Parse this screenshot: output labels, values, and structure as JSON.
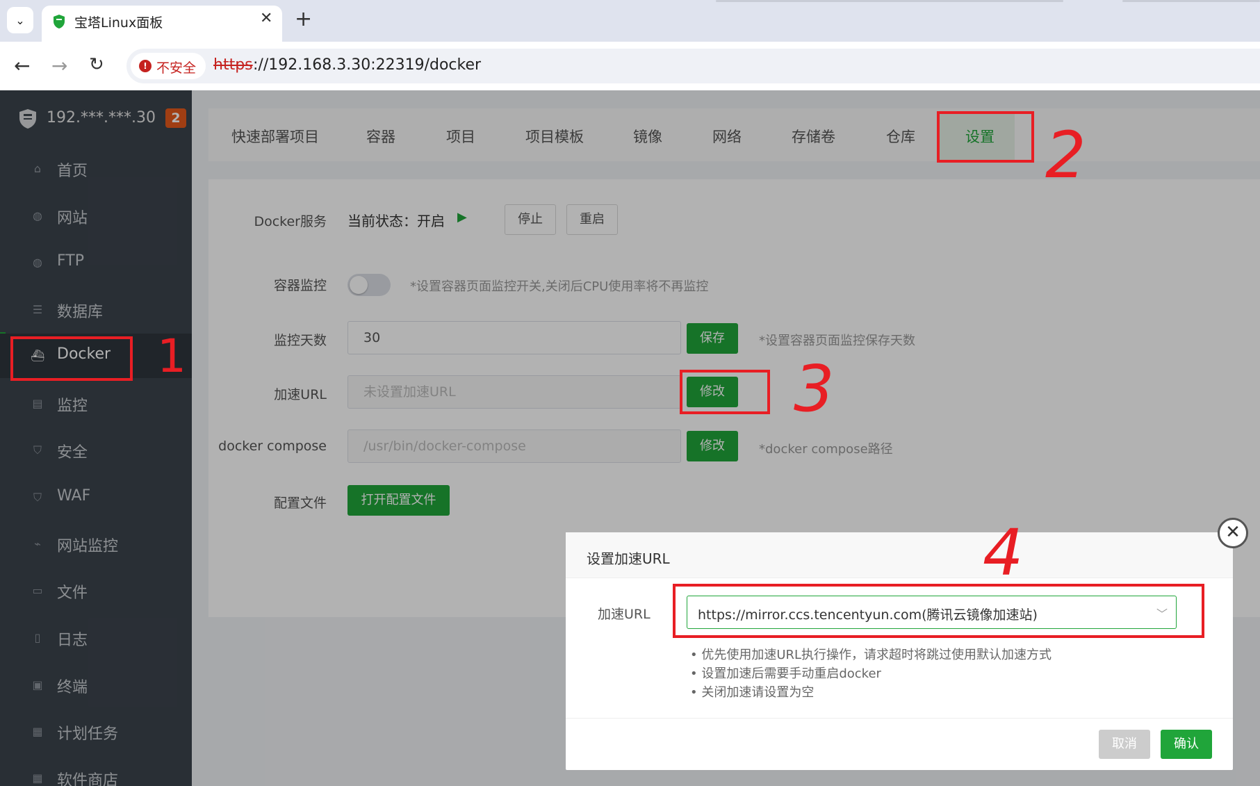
{
  "browser": {
    "tab_title": "宝塔Linux面板",
    "security_label": "不安全",
    "url_scheme": "https",
    "url_rest": "://192.168.3.30:22319/docker"
  },
  "sidebar": {
    "server_ip": "192.***.***.30",
    "badge_count": "2",
    "items": [
      {
        "label": "首页",
        "icon": "home-icon"
      },
      {
        "label": "网站",
        "icon": "globe-icon"
      },
      {
        "label": "FTP",
        "icon": "ftp-icon"
      },
      {
        "label": "数据库",
        "icon": "database-icon"
      },
      {
        "label": "Docker",
        "icon": "docker-icon",
        "active": true
      },
      {
        "label": "监控",
        "icon": "monitor-icon"
      },
      {
        "label": "安全",
        "icon": "shield-icon"
      },
      {
        "label": "WAF",
        "icon": "waf-icon"
      },
      {
        "label": "网站监控",
        "icon": "chart-icon"
      },
      {
        "label": "文件",
        "icon": "folder-icon"
      },
      {
        "label": "日志",
        "icon": "log-icon"
      },
      {
        "label": "终端",
        "icon": "terminal-icon"
      },
      {
        "label": "计划任务",
        "icon": "calendar-icon"
      },
      {
        "label": "软件商店",
        "icon": "apps-icon"
      }
    ]
  },
  "tabs": [
    "快速部署项目",
    "容器",
    "项目",
    "项目模板",
    "镜像",
    "网络",
    "存储卷",
    "仓库",
    "设置"
  ],
  "settings": {
    "service_label": "Docker服务",
    "status_text": "当前状态：开启",
    "stop_button": "停止",
    "restart_button": "重启",
    "monitor_label": "容器监控",
    "monitor_hint": "*设置容器页面监控开关,关闭后CPU使用率将不再监控",
    "monitor_enabled": false,
    "days_label": "监控天数",
    "days_value": "30",
    "save_button": "保存",
    "days_hint": "*设置容器页面监控保存天数",
    "accel_label": "加速URL",
    "accel_placeholder": "未设置加速URL",
    "modify_button": "修改",
    "compose_label": "docker compose",
    "compose_placeholder": "/usr/bin/docker-compose",
    "compose_hint": "*docker compose路径",
    "config_label": "配置文件",
    "open_config_button": "打开配置文件"
  },
  "dialog": {
    "title": "设置加速URL",
    "field_label": "加速URL",
    "selected_value": "https://mirror.ccs.tencentyun.com(腾讯云镜像加速站)",
    "tips": [
      "优先使用加速URL执行操作，请求超时将跳过使用默认加速方式",
      "设置加速后需要手动重启docker",
      "关闭加速请设置为空"
    ],
    "cancel_button": "取消",
    "confirm_button": "确认"
  },
  "annotations": [
    "1",
    "2",
    "3",
    "4"
  ],
  "colors": {
    "accent": "#20a53a",
    "sidebar_bg": "#3c444d",
    "annotation": "#e81e24",
    "badge": "#e65a1c"
  }
}
